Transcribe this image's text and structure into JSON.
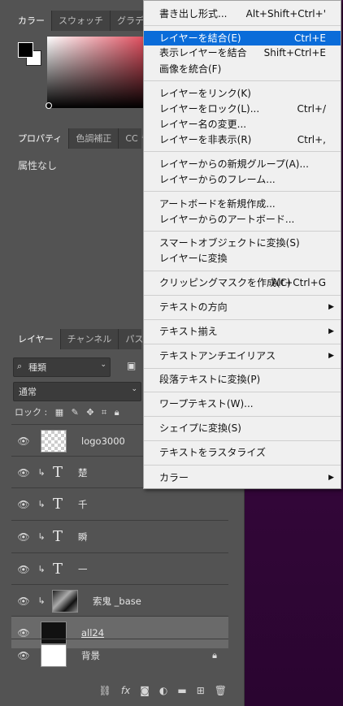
{
  "color_panel": {
    "tabs": [
      "カラー",
      "スウォッチ",
      "グラデーション"
    ]
  },
  "properties_panel": {
    "tabs": [
      "プロパティ",
      "色調補正",
      "CC ライブラリ"
    ],
    "content": "属性なし"
  },
  "layers_panel": {
    "tabs": [
      "レイヤー",
      "チャンネル",
      "パス"
    ],
    "filter": "種類",
    "blend_mode": "通常",
    "lock_label": "ロック :",
    "layers": [
      {
        "name": "logo3000",
        "type": "smart"
      },
      {
        "name": "楚",
        "type": "text"
      },
      {
        "name": "千",
        "type": "text"
      },
      {
        "name": "瞬",
        "type": "text"
      },
      {
        "name": "一",
        "type": "text"
      },
      {
        "name": "索鬼 _base",
        "type": "image"
      },
      {
        "name": "all24",
        "type": "image"
      },
      {
        "name": "背景",
        "type": "background"
      }
    ],
    "bottom_icons": [
      "link-icon",
      "fx-icon",
      "mask-icon",
      "adjustment-icon",
      "group-icon",
      "new-layer-icon",
      "trash-icon"
    ]
  },
  "menu": {
    "items": [
      {
        "label": "書き出し形式...",
        "shortcut": "Alt+Shift+Ctrl+'"
      },
      {
        "label": "レイヤーを結合(E)",
        "shortcut": "Ctrl+E",
        "highlighted": true
      },
      {
        "label": "表示レイヤーを結合",
        "shortcut": "Shift+Ctrl+E"
      },
      {
        "label": "画像を統合(F)",
        "shortcut": ""
      },
      {
        "label": "レイヤーをリンク(K)",
        "shortcut": ""
      },
      {
        "label": "レイヤーをロック(L)...",
        "shortcut": "Ctrl+/"
      },
      {
        "label": "レイヤー名の変更...",
        "shortcut": ""
      },
      {
        "label": "レイヤーを非表示(R)",
        "shortcut": "Ctrl+,"
      },
      {
        "label": "レイヤーからの新規グループ(A)...",
        "shortcut": ""
      },
      {
        "label": "レイヤーからのフレーム...",
        "shortcut": ""
      },
      {
        "label": "アートボードを新規作成...",
        "shortcut": ""
      },
      {
        "label": "レイヤーからのアートボード...",
        "shortcut": ""
      },
      {
        "label": "スマートオブジェクトに変換(S)",
        "shortcut": ""
      },
      {
        "label": "レイヤーに変換",
        "shortcut": ""
      },
      {
        "label": "クリッピングマスクを作成(C)",
        "shortcut": "Alt+Ctrl+G"
      },
      {
        "label": "テキストの方向",
        "shortcut": "",
        "submenu": true
      },
      {
        "label": "テキスト揃え",
        "shortcut": "",
        "submenu": true
      },
      {
        "label": "テキストアンチエイリアス",
        "shortcut": "",
        "submenu": true
      },
      {
        "label": "段落テキストに変換(P)",
        "shortcut": ""
      },
      {
        "label": "ワープテキスト(W)...",
        "shortcut": ""
      },
      {
        "label": "シェイプに変換(S)",
        "shortcut": ""
      },
      {
        "label": "テキストをラスタライズ",
        "shortcut": ""
      },
      {
        "label": "カラー",
        "shortcut": "",
        "submenu": true
      }
    ]
  }
}
